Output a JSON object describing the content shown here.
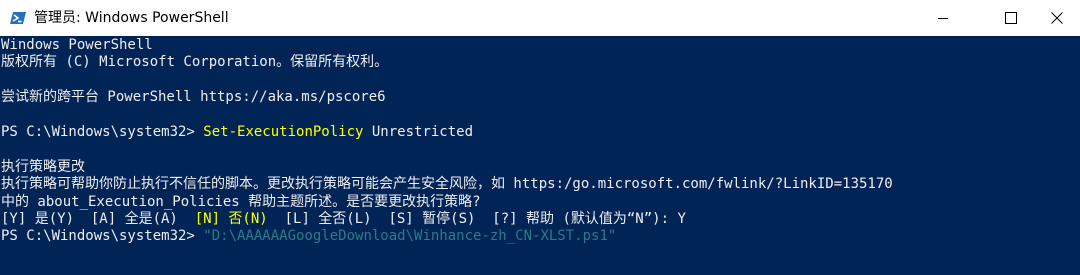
{
  "window": {
    "title": "管理员: Windows PowerShell",
    "icon": "powershell-icon",
    "controls": {
      "minimize": "minimize-icon",
      "maximize": "maximize-icon",
      "close": "close-icon"
    }
  },
  "console": {
    "banner1": "Windows PowerShell",
    "banner2": "版权所有 (C) Microsoft Corporation。保留所有权利。",
    "tip": "尝试新的跨平台 PowerShell https://aka.ms/pscore6",
    "prompt": "PS C:\\Windows\\system32> ",
    "cmd1_name": "Set-ExecutionPolicy",
    "cmd1_arg": " Unrestricted",
    "confirm_title": "执行策略更改",
    "confirm_body1": "执行策略可帮助你防止执行不信任的脚本。更改执行策略可能会产生安全风险，如 https:/go.microsoft.com/fwlink/?LinkID=135170",
    "confirm_body2": "中的 about_Execution_Policies 帮助主题所述。是否要更改执行策略?",
    "choice_y": "[Y] 是(Y)  [A] 全是(A)  ",
    "choice_n": "[N] 否(N)",
    "choice_rest": "  [L] 全否(L)  [S] 暂停(S)  [?] 帮助 (默认值为“N”): Y",
    "cmd2_arg": "\"D:\\AAAAAAGoogleDownload\\Winhance-zh_CN-XLST.ps1\""
  },
  "colors": {
    "console_bg": "#012456",
    "text": "#eeedf0",
    "command": "#ffff00",
    "string_arg": "#2d7a8c"
  }
}
